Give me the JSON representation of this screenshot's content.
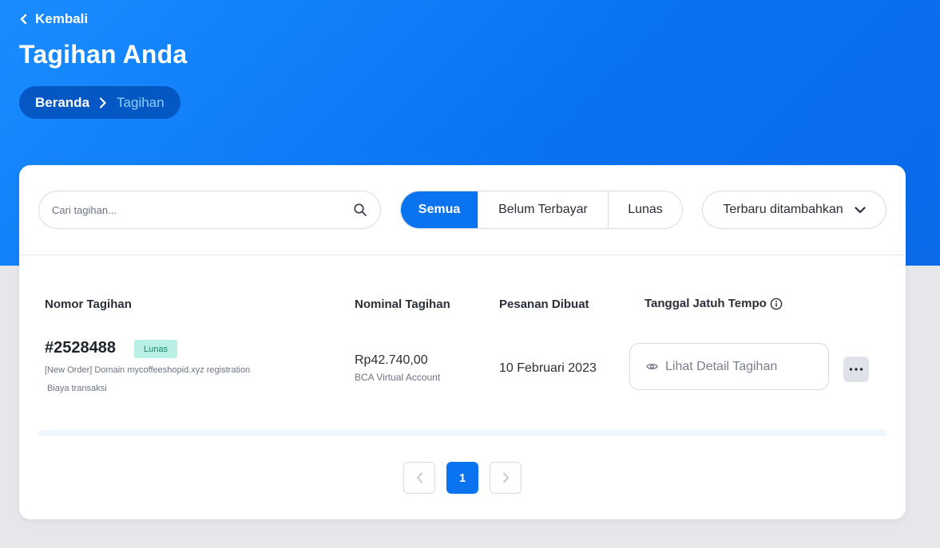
{
  "header": {
    "back_label": "Kembali",
    "title": "Tagihan Anda",
    "breadcrumb": {
      "home": "Beranda",
      "current": "Tagihan"
    }
  },
  "toolbar": {
    "search_placeholder": "Cari tagihan...",
    "filters": [
      {
        "label": "Semua",
        "active": true
      },
      {
        "label": "Belum Terbayar",
        "active": false
      },
      {
        "label": "Lunas",
        "active": false
      }
    ],
    "sort_label": "Terbaru ditambahkan"
  },
  "table": {
    "columns": {
      "invoice_number": "Nomor Tagihan",
      "amount": "Nominal Tagihan",
      "created": "Pesanan Dibuat",
      "due_date": "Tanggal Jatuh Tempo"
    },
    "rows": [
      {
        "invoice_number": "#2528488",
        "status": "Lunas",
        "description": "[New Order] Domain mycoffeeshopid.xyz registration",
        "fee_note": "Biaya transaksi",
        "amount": "Rp42.740,00",
        "payment_method": "BCA Virtual Account",
        "created": "10 Februari 2023",
        "detail_label": "Lihat Detail Tagihan"
      }
    ]
  },
  "pagination": {
    "current_page": "1"
  },
  "colors": {
    "primary": "#0a74f0",
    "hero": "#1a8cff",
    "breadcrumb_bg": "#0557c4",
    "badge_bg": "#b8f0e6",
    "badge_text": "#13886e"
  },
  "icons": {
    "back": "chevron-left-icon",
    "breadcrumb_sep": "chevron-right-icon",
    "search": "search-icon",
    "sort": "chevron-down-icon",
    "info": "info-icon",
    "detail": "eye-icon",
    "more": "more-horizontal-icon",
    "prev": "chevron-left-icon",
    "next": "chevron-right-icon"
  }
}
